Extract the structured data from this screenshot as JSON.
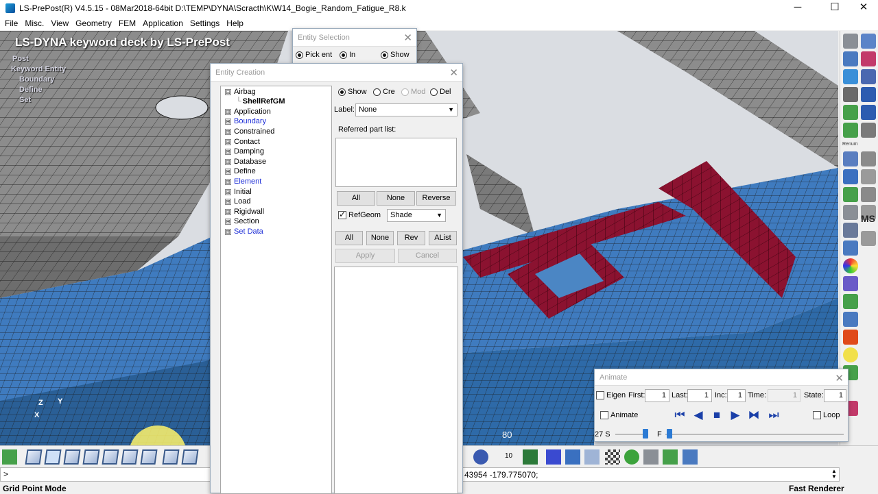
{
  "window": {
    "title": "LS-PrePost(R) V4.5.15 - 08Mar2018-64bit D:\\TEMP\\DYNA\\Scracth\\K\\W14_Bogie_Random_Fatigue_R8.k",
    "minimize": "─",
    "maximize": "☐",
    "close": "✕"
  },
  "menu": [
    "File",
    "Misc.",
    "View",
    "Geometry",
    "FEM",
    "Application",
    "Settings",
    "Help"
  ],
  "viewport": {
    "title": "LS-DYNA keyword deck by LS-PrePost",
    "tree": [
      "Post",
      "Keyword Entity",
      "Boundary",
      "Define",
      "Set"
    ],
    "axis_x": "X",
    "axis_y": "Y",
    "axis_z": "Z",
    "scale_label": "80",
    "mesh_colors": {
      "steel": "#8c8c8c",
      "plate": "#3f7bbf",
      "weld": "#8b1230",
      "mesh_line": "#1a1a1a"
    }
  },
  "entity_selection": {
    "title": "Entity Selection",
    "pick_ent": "Pick ent",
    "in": "In",
    "show": "Show"
  },
  "entity_creation": {
    "title": "Entity Creation",
    "tree": [
      {
        "label": "Airbag",
        "box": "⊟",
        "blue": false
      },
      {
        "label": "ShellRefGM",
        "box": "",
        "blue": false,
        "child": true
      },
      {
        "label": "Application",
        "box": "⊞",
        "blue": false
      },
      {
        "label": "Boundary",
        "box": "⊞",
        "blue": true
      },
      {
        "label": "Constrained",
        "box": "⊞",
        "blue": false
      },
      {
        "label": "Contact",
        "box": "⊞",
        "blue": false
      },
      {
        "label": "Damping",
        "box": "⊞",
        "blue": false
      },
      {
        "label": "Database",
        "box": "⊞",
        "blue": false
      },
      {
        "label": "Define",
        "box": "⊞",
        "blue": false
      },
      {
        "label": "Element",
        "box": "⊞",
        "blue": true
      },
      {
        "label": "Initial",
        "box": "⊞",
        "blue": false
      },
      {
        "label": "Load",
        "box": "⊞",
        "blue": false
      },
      {
        "label": "Rigidwall",
        "box": "⊞",
        "blue": false
      },
      {
        "label": "Section",
        "box": "⊞",
        "blue": false
      },
      {
        "label": "Set Data",
        "box": "⊞",
        "blue": true
      }
    ],
    "modes": {
      "show": "Show",
      "cre": "Cre",
      "mod": "Mod",
      "del": "Del",
      "selected": "Show"
    },
    "label_caption": "Label:",
    "label_value": "None",
    "referred_part_list": "Referred part list:",
    "list_buttons": {
      "all": "All",
      "none": "None",
      "reverse": "Reverse"
    },
    "refgeom_label": "RefGeom",
    "refgeom_checked": true,
    "shade_value": "Shade",
    "action_buttons": {
      "all": "All",
      "none": "None",
      "rev": "Rev",
      "alist": "AList"
    },
    "apply": "Apply",
    "cancel": "Cancel"
  },
  "animate": {
    "title": "Animate",
    "eigen": "Eigen",
    "first_label": "First:",
    "first_value": "1",
    "last_label": "Last:",
    "last_value": "1",
    "inc_label": "Inc:",
    "inc_value": "1",
    "time_label": "Time:",
    "time_value": "1",
    "state_label": "State:",
    "state_value": "1",
    "animate_label": "Animate",
    "loop_label": "Loop",
    "speed_label": "27 S",
    "f_label": "F",
    "playback": {
      "first": "⏮",
      "back": "◀",
      "stop": "■",
      "play": "▶",
      "step": "⧓",
      "last": "⏭"
    }
  },
  "bottom_toolbar": {
    "zoom_value": "10"
  },
  "command": {
    "prompt": ">",
    "output": "43954 -179.775070;"
  },
  "status": {
    "mode": "Grid Point Mode",
    "renderer": "Fast Renderer"
  },
  "right_toolbar": {
    "renum_label": "Renum",
    "ms_label": "MS"
  }
}
